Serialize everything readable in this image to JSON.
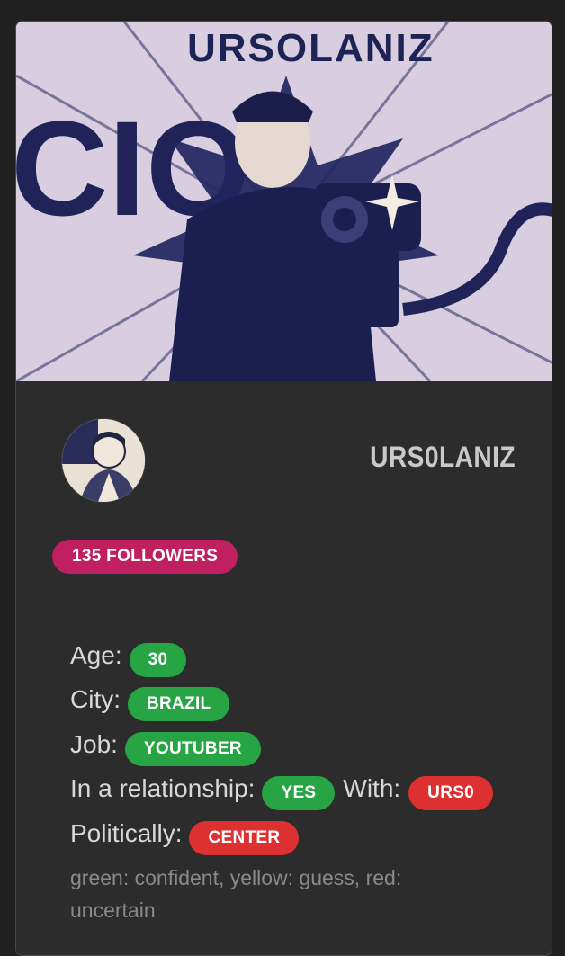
{
  "banner": {
    "title": "URSOLANIZ",
    "side_text": "CIO"
  },
  "profile": {
    "username": "URS0LANIZ",
    "followers_label": "135 FOLLOWERS"
  },
  "info": {
    "age_label": "Age:",
    "age_value": "30",
    "city_label": "City:",
    "city_value": "BRAZIL",
    "job_label": "Job:",
    "job_value": "YOUTUBER",
    "relationship_label": "In a relationship:",
    "relationship_value": "YES",
    "with_label": "With:",
    "with_value": "URS0",
    "political_label": "Politically:",
    "political_value": "CENTER",
    "legend": "green: confident, yellow: guess, red: uncertain"
  },
  "colors": {
    "confident": "#27a545",
    "uncertain": "#dc3031",
    "followers_badge": "#c0205f"
  },
  "icons": {
    "banner_image": "person-with-camera-illustration",
    "avatar_image": "cartoon-portrait"
  }
}
